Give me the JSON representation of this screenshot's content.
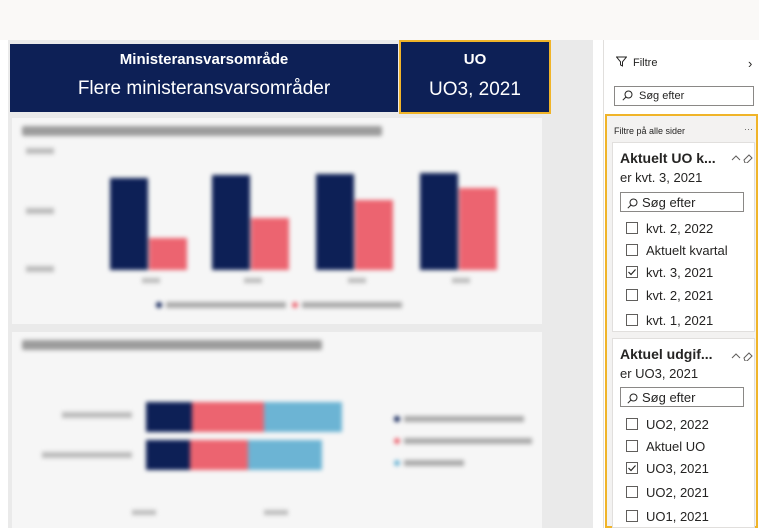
{
  "header": {
    "left_title": "Ministeransvarsområde",
    "left_value": "Flere ministeransvarsområder",
    "right_title": "UO",
    "right_value": "UO3, 2021"
  },
  "colors": {
    "navy": "#0d2056",
    "coral": "#ec6470",
    "lightblue": "#6cb4d4",
    "highlight": "#f0b429"
  },
  "filters_pane": {
    "title": "Filtre",
    "search_placeholder": "Søg efter",
    "section_label": "Filtre på alle sider",
    "more_label": "···",
    "cards": [
      {
        "title": "Aktuelt UO k...",
        "subtitle": "er kvt. 3, 2021",
        "search_placeholder": "Søg efter",
        "options": [
          {
            "label": "kvt. 2, 2022",
            "checked": false
          },
          {
            "label": "Aktuelt kvartal",
            "checked": false
          },
          {
            "label": "kvt. 3, 2021",
            "checked": true
          },
          {
            "label": "kvt. 2, 2021",
            "checked": false
          },
          {
            "label": "kvt. 1, 2021",
            "checked": false
          }
        ]
      },
      {
        "title": "Aktuel udgif...",
        "subtitle": "er UO3, 2021",
        "search_placeholder": "Søg efter",
        "options": [
          {
            "label": "UO2, 2022",
            "checked": false
          },
          {
            "label": "Aktuel UO",
            "checked": false
          },
          {
            "label": "UO3, 2021",
            "checked": true
          },
          {
            "label": "UO2, 2021",
            "checked": false
          },
          {
            "label": "UO1, 2021",
            "checked": false
          }
        ]
      }
    ]
  }
}
